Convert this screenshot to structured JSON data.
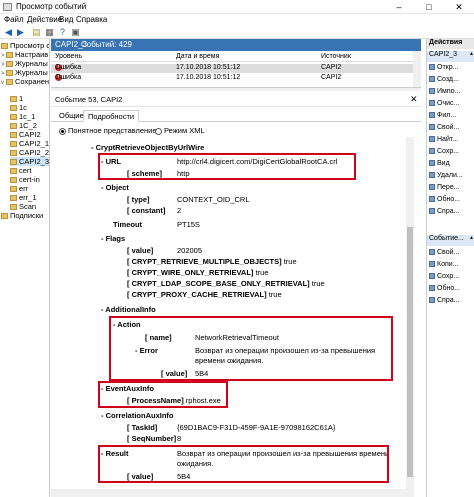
{
  "window": {
    "title": "Просмотр событий",
    "buttons": [
      "–",
      "□",
      "✕"
    ]
  },
  "menu": [
    "Файл",
    "Действие",
    "Вид",
    "Справка"
  ],
  "toolbar_icons": [
    "back-icon",
    "forward-icon",
    "folder-icon",
    "grid-icon",
    "help-icon",
    "panel-icon"
  ],
  "tree": {
    "items": [
      {
        "label": "Просмотр со",
        "indent": 0,
        "twisty": "",
        "selected": false
      },
      {
        "label": "Настраив",
        "indent": 1,
        "twisty": ">",
        "selected": false
      },
      {
        "label": "Журналы",
        "indent": 1,
        "twisty": ">",
        "selected": false
      },
      {
        "label": "Журналы",
        "indent": 1,
        "twisty": ">",
        "selected": false
      },
      {
        "label": "Сохранен",
        "indent": 1,
        "twisty": "v",
        "selected": false
      },
      {
        "label": "1",
        "indent": 2,
        "twisty": "",
        "selected": false
      },
      {
        "label": "1c",
        "indent": 2,
        "twisty": "",
        "selected": false
      },
      {
        "label": "1c_1",
        "indent": 2,
        "twisty": "",
        "selected": false
      },
      {
        "label": "1C_2",
        "indent": 2,
        "twisty": "",
        "selected": false
      },
      {
        "label": "CAPI2",
        "indent": 2,
        "twisty": "",
        "selected": false
      },
      {
        "label": "CAPI2_1",
        "indent": 2,
        "twisty": "",
        "selected": false
      },
      {
        "label": "CAPI2_2",
        "indent": 2,
        "twisty": "",
        "selected": false
      },
      {
        "label": "CAPI2_3",
        "indent": 2,
        "twisty": "",
        "selected": true
      },
      {
        "label": "cert",
        "indent": 2,
        "twisty": "",
        "selected": false
      },
      {
        "label": "cert-in",
        "indent": 2,
        "twisty": "",
        "selected": false
      },
      {
        "label": "err",
        "indent": 2,
        "twisty": "",
        "selected": false
      },
      {
        "label": "err_1",
        "indent": 2,
        "twisty": "",
        "selected": false
      },
      {
        "label": "Scan",
        "indent": 2,
        "twisty": "",
        "selected": false
      },
      {
        "label": "Подписки",
        "indent": 1,
        "twisty": "",
        "selected": false
      }
    ]
  },
  "log": {
    "name": "CAPI2_3",
    "count": "Событий: 429",
    "columns": [
      "Уровень",
      "Дата и время",
      "Источник"
    ],
    "rows": [
      {
        "level": "Ошибка",
        "datetime": "17.10.2018 10:51:12",
        "source": "CAPI2",
        "selected": true
      },
      {
        "level": "Ошибка",
        "datetime": "17.10.2018 10:51:12",
        "source": "CAPI2",
        "selected": false
      }
    ]
  },
  "event": {
    "title": "Событие 53, CAPI2",
    "close": "✕",
    "tabs": [
      "Общие",
      "Подробности"
    ],
    "active_tab": "Подробности",
    "view_modes": [
      "Понятное представление",
      "Режим XML"
    ],
    "active_view": "Понятное представление"
  },
  "detail": {
    "l01": {
      "k": "- CryptRetrieveObjectByUrlWire"
    },
    "l02": {
      "k": "- URL",
      "v": "http://crl4.digicert.com/DigiCertGlobalRootCA.crl"
    },
    "l03": {
      "k": "[ scheme]",
      "v": "http"
    },
    "l04": {
      "k": "- Object"
    },
    "l05": {
      "k": "[ type]",
      "v": "CONTEXT_OID_CRL"
    },
    "l06": {
      "k": "[ constant]",
      "v": "2"
    },
    "l07": {
      "k": "Timeout",
      "v": "PT15S"
    },
    "l08": {
      "k": "- Flags"
    },
    "l09": {
      "k": "[ value]",
      "v": "202005"
    },
    "l10": {
      "k": "[ CRYPT_RETRIEVE_MULTIPLE_OBJECTS]",
      "v": "true"
    },
    "l11": {
      "k": "[ CRYPT_WIRE_ONLY_RETRIEVAL]",
      "v": "true"
    },
    "l12": {
      "k": "[ CRYPT_LDAP_SCOPE_BASE_ONLY_RETRIEVAL]",
      "v": "true"
    },
    "l13": {
      "k": "[ CRYPT_PROXY_CACHE_RETRIEVAL]",
      "v": "true"
    },
    "l14": {
      "k": "- AdditionalInfo"
    },
    "l15": {
      "k": "- Action"
    },
    "l16": {
      "k": "[ name]",
      "v": "NetworkRetrievalTimeout"
    },
    "l17": {
      "k": "- Error",
      "v": "Возврат из операции произошел из-за превышения"
    },
    "l17b": {
      "v": "времени ожидания."
    },
    "l18": {
      "k": "[ value]",
      "v": "5B4"
    },
    "l19": {
      "k": "- EventAuxInfo"
    },
    "l20": {
      "k": "[ ProcessName]",
      "v": "rphost.exe"
    },
    "l21": {
      "k": "- CorrelationAuxInfo"
    },
    "l22": {
      "k": "[ TaskId]",
      "v": "{69D1BAC9-F31D-459F-9A1E-97098162C61A}"
    },
    "l23": {
      "k": "[ SeqNumber]",
      "v": "8"
    },
    "l24": {
      "k": "- Result",
      "v": "Возврат из операции произошел из-за превышения времени"
    },
    "l24b": {
      "v": "ожидания."
    },
    "l25": {
      "k": "[ value]",
      "v": "5B4"
    }
  },
  "actions": {
    "header": "Действия",
    "section1": "CAPI2_3",
    "items1": [
      "Откр...",
      "Созд...",
      "Импо...",
      "Очис...",
      "Фил...",
      "Свой...",
      "Найт...",
      "Сохр...",
      "Вид",
      "Удали...",
      "Пере...",
      "Обно...",
      "Спра..."
    ],
    "section2": "Событие...",
    "items2": [
      "Свой...",
      "Копи...",
      "Сохр...",
      "Обно...",
      "Спра..."
    ]
  }
}
